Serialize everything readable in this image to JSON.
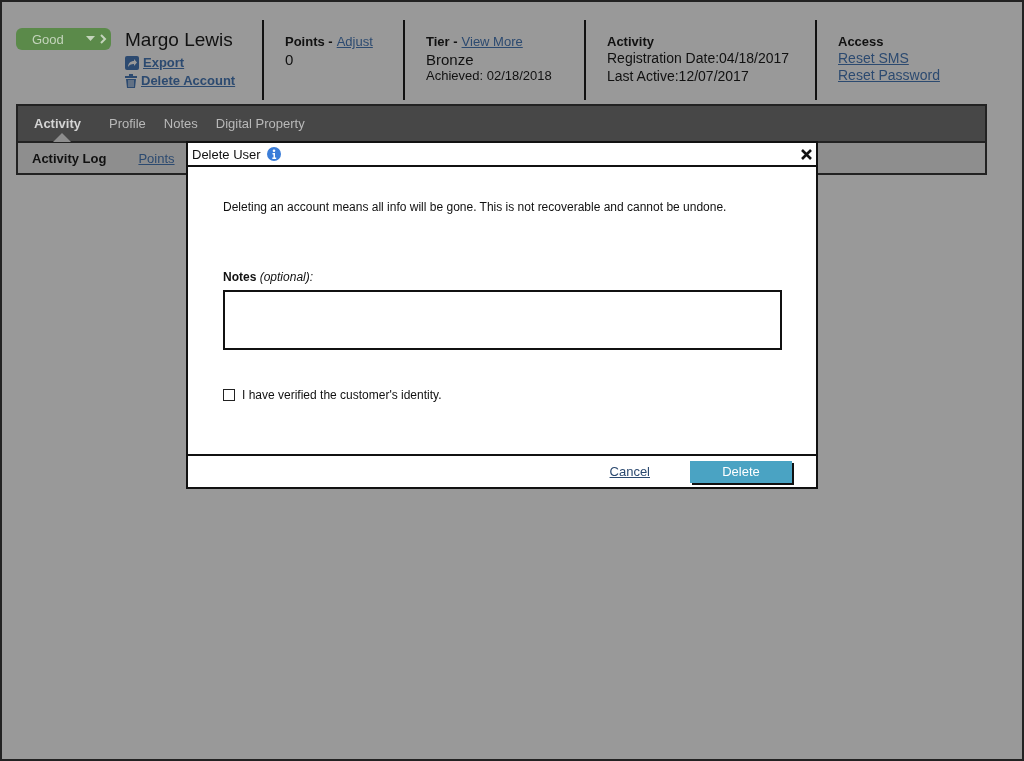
{
  "status": {
    "label": "Good"
  },
  "customer": {
    "name": "Margo Lewis",
    "actions": [
      {
        "label": "Export",
        "kind": "export"
      },
      {
        "label": "Delete Account",
        "kind": "delete"
      }
    ]
  },
  "points": {
    "heading": "Points -",
    "link": "Adjust",
    "value": "0"
  },
  "tier": {
    "heading": "Tier -",
    "link": "View More",
    "value": "Bronze",
    "achieved": "Achieved: 02/18/2018"
  },
  "activity": {
    "heading": "Activity",
    "lines": [
      "Registration Date:04/18/2017",
      "Last Active:12/07/2017"
    ]
  },
  "access": {
    "heading": "Access",
    "links": [
      "Reset SMS",
      "Reset Password"
    ]
  },
  "tabs": [
    {
      "label": "Activity",
      "selected": true
    },
    {
      "label": "Profile",
      "selected": false
    },
    {
      "label": "Notes",
      "selected": false
    },
    {
      "label": "Digital Property",
      "selected": false
    }
  ],
  "subtabs": [
    {
      "label": "Activity Log",
      "selected": true
    },
    {
      "label": "Points",
      "selected": false
    }
  ],
  "dialog": {
    "title": "Delete User",
    "message": "Deleting an account means all info will be gone. This is not recoverable and cannot be undone.",
    "notes_label": "**Notes** *(optional):*",
    "checkbox": {
      "label": "I have verified the customer's identity.",
      "checked": false
    },
    "cancel": "Cancel",
    "confirm": "Delete"
  }
}
